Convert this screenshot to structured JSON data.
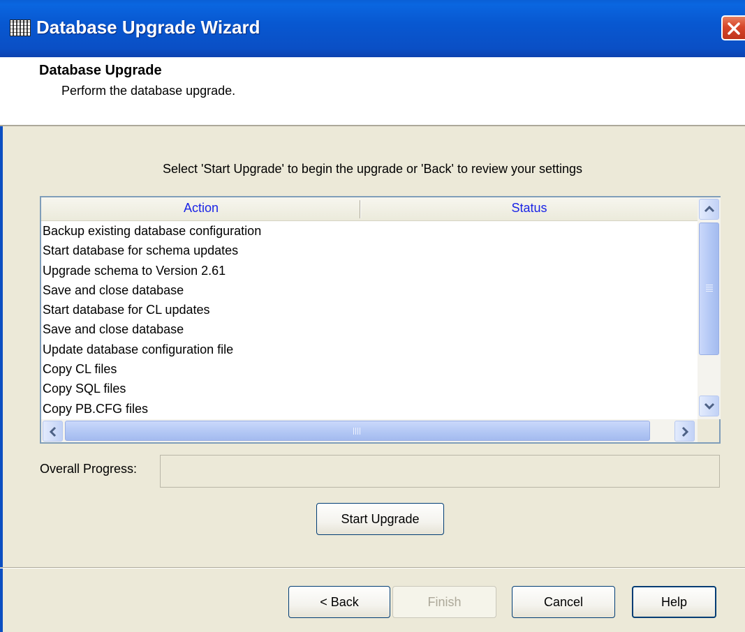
{
  "window": {
    "title": "Database Upgrade Wizard",
    "icon": "database-wizard-icon",
    "close_icon": "close-icon"
  },
  "header": {
    "title": "Database Upgrade",
    "subtitle": "Perform the database upgrade."
  },
  "instruction": "Select 'Start Upgrade' to begin the upgrade or 'Back' to review your settings",
  "table": {
    "columns": [
      "Action",
      "Status"
    ],
    "rows": [
      "Backup existing database configuration",
      "Start database for schema updates",
      "Upgrade schema to Version 2.61",
      "Save and close database",
      "Start database for CL updates",
      "Save and close database",
      "Update database configuration file",
      "Copy CL files",
      "Copy SQL files",
      "Copy PB.CFG files"
    ]
  },
  "progress": {
    "label": "Overall Progress:",
    "value_percent": 0
  },
  "buttons": {
    "start_upgrade": "Start Upgrade",
    "back": "< Back",
    "finish": "Finish",
    "cancel": "Cancel",
    "help": "Help"
  },
  "colors": {
    "titlebar": "#0a58d1",
    "column_header_text": "#1a24e6",
    "dialog_background": "#ece9d8"
  }
}
